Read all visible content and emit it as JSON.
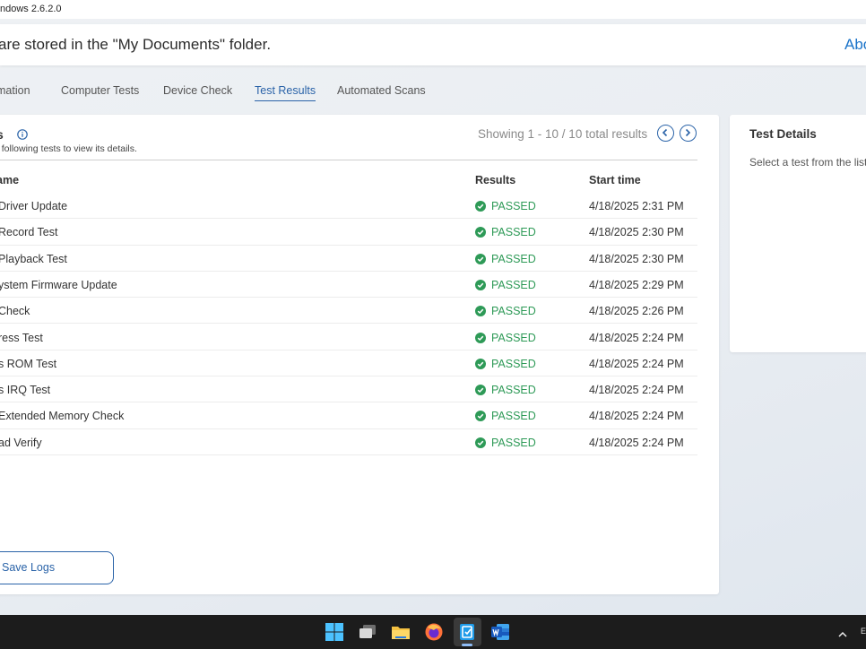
{
  "window": {
    "title": "ndows 2.6.2.0"
  },
  "notice": {
    "message": "are stored in the \"My Documents\" folder.",
    "about_link": "Abo"
  },
  "tabs": [
    {
      "label": "mation"
    },
    {
      "label": "Computer Tests"
    },
    {
      "label": "Device Check"
    },
    {
      "label": "Test Results",
      "active": true
    },
    {
      "label": "Automated Scans"
    }
  ],
  "results": {
    "title": "s",
    "subtitle": "e following tests to view its details.",
    "showing": "Showing 1 - 10 / 10 total results",
    "columns": {
      "name": "ame",
      "results": "Results",
      "start": "Start time"
    },
    "rows": [
      {
        "name": "Driver Update",
        "status": "PASSED",
        "time": "4/18/2025 2:31 PM"
      },
      {
        "name": "Record Test",
        "status": "PASSED",
        "time": "4/18/2025 2:30 PM"
      },
      {
        "name": "Playback Test",
        "status": "PASSED",
        "time": "4/18/2025 2:30 PM"
      },
      {
        "name": "ystem Firmware Update",
        "status": "PASSED",
        "time": "4/18/2025 2:29 PM"
      },
      {
        "name": "Check",
        "status": "PASSED",
        "time": "4/18/2025 2:26 PM"
      },
      {
        "name": "ress Test",
        "status": "PASSED",
        "time": "4/18/2025 2:24 PM"
      },
      {
        "name": "s ROM Test",
        "status": "PASSED",
        "time": "4/18/2025 2:24 PM"
      },
      {
        "name": "s IRQ Test",
        "status": "PASSED",
        "time": "4/18/2025 2:24 PM"
      },
      {
        "name": "Extended Memory Check",
        "status": "PASSED",
        "time": "4/18/2025 2:24 PM"
      },
      {
        "name": "ad Verify",
        "status": "PASSED",
        "time": "4/18/2025 2:24 PM"
      }
    ],
    "save_label": "Save Logs"
  },
  "details": {
    "title": "Test Details",
    "text": "Select a test from the list"
  },
  "taskbar": {
    "icons": [
      "windows-start-icon",
      "task-view-icon",
      "file-explorer-icon",
      "firefox-icon",
      "diagnostic-app-icon",
      "word-icon"
    ],
    "tray_text": "E"
  },
  "colors": {
    "accent": "#2a63a8",
    "passed": "#2e9a57",
    "taskbar": "#1c1c1c"
  }
}
